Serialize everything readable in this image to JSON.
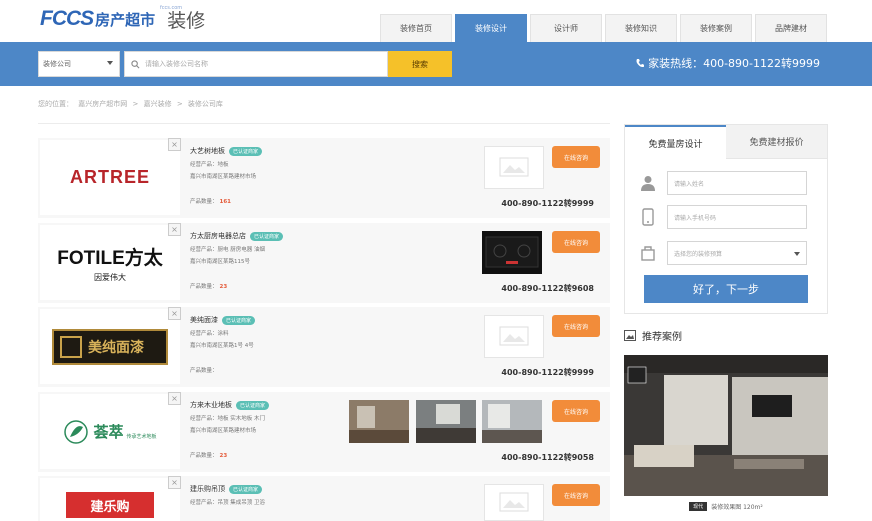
{
  "header": {
    "logo_word": "FCCS",
    "logo_cn": "房产超市",
    "logo_domain": "fccs.com",
    "section": "装修",
    "nav": [
      {
        "label": "装修首页",
        "active": false
      },
      {
        "label": "装修设计",
        "active": true
      },
      {
        "label": "设计师",
        "active": false
      },
      {
        "label": "装修知识",
        "active": false
      },
      {
        "label": "装修案例",
        "active": false
      },
      {
        "label": "品牌建材",
        "active": false
      }
    ]
  },
  "search": {
    "type_value": "装修公司",
    "placeholder": "请输入装修公司名称",
    "button": "搜索"
  },
  "hotline": "家装热线：400-890-1122转9999",
  "breadcrumb": [
    "您的位置：",
    "嘉兴房产超市网",
    ">",
    "嘉兴装修",
    ">",
    "装修公司库"
  ],
  "companies": [
    {
      "name": "大艺树地板",
      "badge": "已认证商家",
      "line1": "经营产品：地板",
      "line2": "嘉兴市南湖区某路建材市场",
      "count_label": "产品数量：",
      "count": "161",
      "phone": "400-890-1122转9999",
      "logo": "ARTREE",
      "consult": "在线咨询"
    },
    {
      "name": "方太厨房电器总店",
      "badge": "已认证商家",
      "line1": "经营产品：厨电 厨房电器 油烟",
      "line2": "嘉兴市南湖区某路115号",
      "count_label": "产品数量：",
      "count": "23",
      "phone": "400-890-1122转9608",
      "logo": "FOTILE方太",
      "logo_sub": "因爱伟大",
      "consult": "在线咨询"
    },
    {
      "name": "美纯面漆",
      "badge": "已认证商家",
      "line1": "经营产品：涂料",
      "line2": "嘉兴市南湖区某路1号 4号",
      "count_label": "产品数量：",
      "count": "",
      "phone": "400-890-1122转9999",
      "logo": "美纯面漆",
      "consult": "在线咨询"
    },
    {
      "name": "方来木业地板",
      "badge": "已认证商家",
      "line1": "经营产品：地板 实木地板 木门",
      "line2": "嘉兴市南湖区某路建材市场",
      "count_label": "产品数量：",
      "count": "23",
      "phone": "400-890-1122转9058",
      "logo": "荟萃",
      "logo_sub": "传承艺术地板",
      "consult": "在线咨询"
    },
    {
      "name": "建乐购吊顶",
      "badge": "已认证商家",
      "line1": "经营产品：吊顶 集成吊顶 卫浴",
      "line2": "",
      "count_label": "",
      "count": "",
      "phone": "",
      "logo": "建乐购",
      "consult": "在线咨询"
    }
  ],
  "panel": {
    "tabs": [
      "免费量房设计",
      "免费建材报价"
    ],
    "name_placeholder": "请输入姓名",
    "phone_placeholder": "请输入手机号码",
    "area_placeholder": "选择您的装修预算",
    "submit": "好了，下一步"
  },
  "cases": {
    "title": "推荐案例",
    "caption_tag": "现代",
    "caption": "装修效果图 120m²"
  },
  "colors": {
    "brand_blue": "#4d87c7",
    "search_yellow": "#f5c129",
    "consult_orange": "#f28c3a",
    "badge_teal": "#5bbfb5"
  }
}
